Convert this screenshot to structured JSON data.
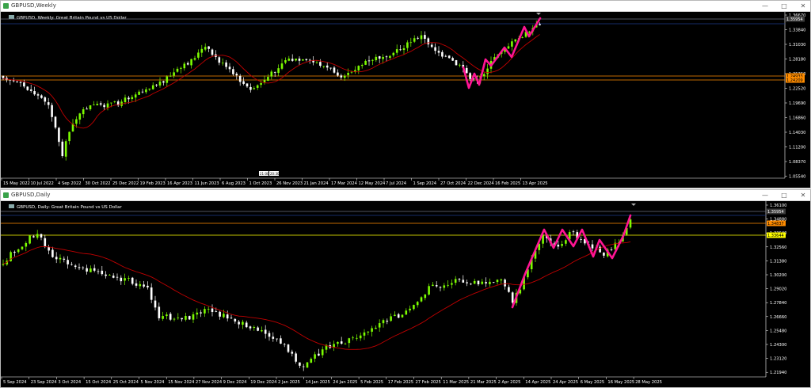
{
  "colors": {
    "bull": "#7CFC00",
    "bear": "#FFFFFF",
    "ma": "#C00000",
    "pattern": "#FF1493",
    "orange_line": "#FF8C00",
    "yellow_line": "#FFFF00",
    "blue_line": "#1E3A8A",
    "grid_text": "#FFFFFF",
    "price_tag_bg": "#3C3C3C"
  },
  "weekly": {
    "window_title": "GBPUSD,Weekly",
    "symbol_info": "GBPUSD, Weekly:  Great Britain Pound vs US Dollar",
    "window_buttons": {
      "minimize": "—",
      "maximize": "□",
      "close": "✕"
    },
    "price_labels": [
      "1.36670",
      "1.33840",
      "1.31030",
      "1.28180",
      "1.25350",
      "1.22520",
      "1.19690",
      "1.16860",
      "1.14030",
      "1.11200",
      "1.08370",
      "1.05540"
    ],
    "price_tags": {
      "top": "1.35954",
      "orange_a": "1.24933",
      "orange_b": "1.24209"
    },
    "date_labels": [
      "15 May 2022",
      "10 Jul 2022",
      "4 Sep 2022",
      "30 Oct 2022",
      "25 Dec 2022",
      "19 Feb 2023",
      "16 Apr 2023",
      "11 Jun 2023",
      "6 Aug 2023",
      "1 Oct 2023",
      "26 Nov 2023",
      "21 Jan 2024",
      "17 Mar 2024",
      "12 May 2024",
      "7 Jul 2024",
      "1 Sep 2024",
      "27 Oct 2024",
      "22 Dec 2024",
      "16 Feb 2025",
      "13 Apr 2025"
    ],
    "crosshair_tag": "21:00:30",
    "crosshair_tag2": "20:30"
  },
  "daily": {
    "window_title": "GBPUSD,Daily",
    "symbol_info": "GBPUSD, Daily:  Great Britain Pound vs US Dollar",
    "window_buttons": {
      "minimize": "—",
      "maximize": "□",
      "close": "✕"
    },
    "price_labels": [
      "1.36100",
      "1.34880",
      "1.33640",
      "1.32560",
      "1.31380",
      "1.30200",
      "1.29020",
      "1.27840",
      "1.26660",
      "1.25480",
      "1.24300",
      "1.23120",
      "1.21940"
    ],
    "price_tags": {
      "top": "1.35954",
      "orange": "1.34837",
      "yellow": "1.33644"
    },
    "date_labels": [
      "5 Sep 2024",
      "23 Sep 2024",
      "3 Oct 2024",
      "15 Oct 2024",
      "25 Oct 2024",
      "5 Nov 2024",
      "15 Nov 2024",
      "27 Nov 2024",
      "9 Dec 2024",
      "19 Dec 2024",
      "2 Jan 2025",
      "14 Jan 2025",
      "24 Jan 2025",
      "5 Feb 2025",
      "17 Feb 2025",
      "27 Feb 2025",
      "11 Mar 2025",
      "21 Mar 2025",
      "2 Apr 2025",
      "14 Apr 2025",
      "24 Apr 2025",
      "6 May 2025",
      "16 May 2025",
      "28 May 2025"
    ]
  }
}
